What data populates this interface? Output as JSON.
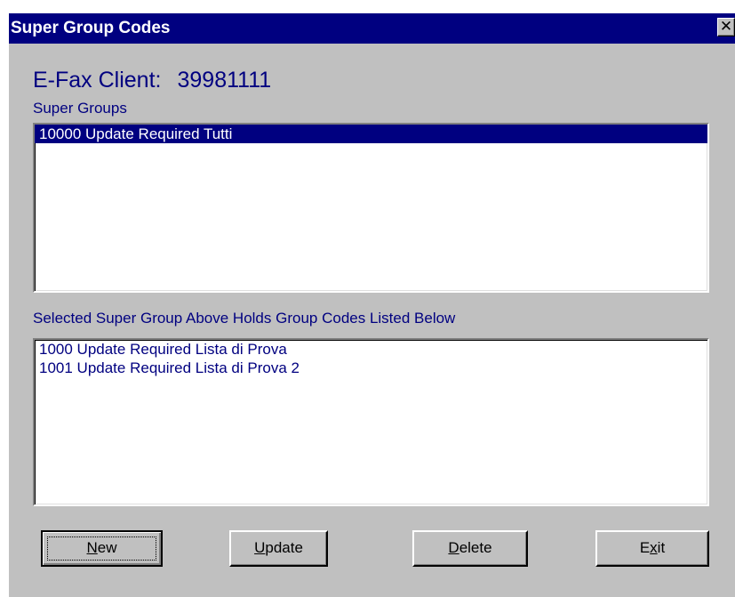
{
  "window": {
    "title": "Super Group Codes",
    "close_glyph": "✕"
  },
  "client": {
    "label": "E-Fax Client:",
    "id": "39981111"
  },
  "super_groups": {
    "label": "Super Groups",
    "items": [
      "10000 Update Required Tutti"
    ],
    "selected_index": 0
  },
  "group_codes": {
    "label": "Selected Super Group Above Holds Group Codes Listed Below",
    "items": [
      "1000 Update Required Lista di Prova",
      "1001 Update Required Lista di Prova 2"
    ]
  },
  "buttons": {
    "new": {
      "before": "",
      "mnemonic": "N",
      "after": "ew"
    },
    "update": {
      "before": "",
      "mnemonic": "U",
      "after": "pdate"
    },
    "delete": {
      "before": "",
      "mnemonic": "D",
      "after": "elete"
    },
    "exit": {
      "before": "E",
      "mnemonic": "x",
      "after": "it"
    }
  },
  "colors": {
    "titlebar": "#000080",
    "dialog_bg": "#c0c0c0",
    "text": "#000080",
    "selection": "#000080"
  }
}
